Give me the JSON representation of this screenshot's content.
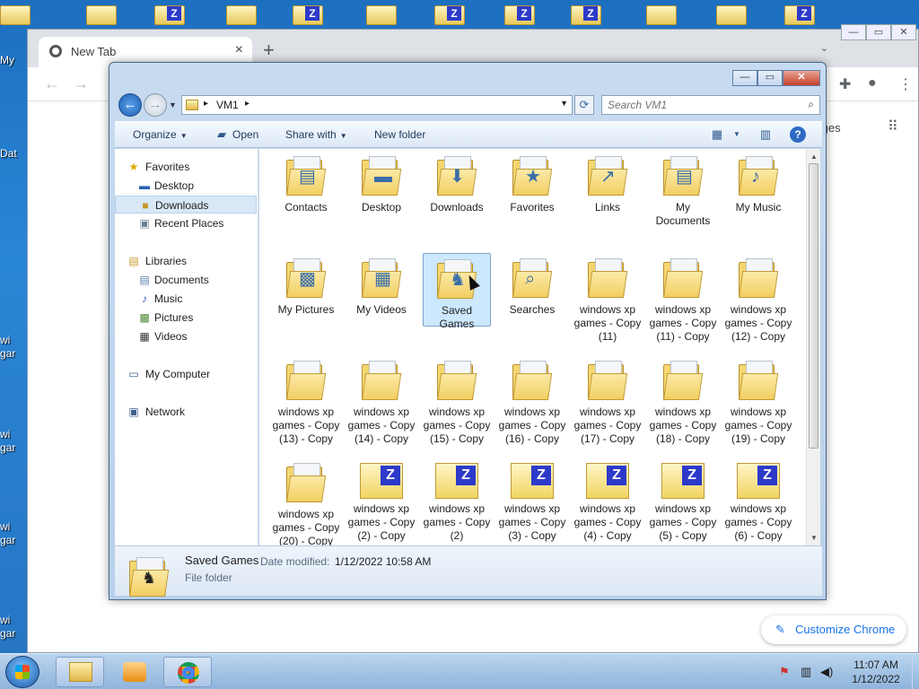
{
  "desktop": {
    "left_labels": [
      "My",
      "Dat",
      "wi",
      "gar",
      "wi",
      "gar",
      "wi",
      "gar",
      "wi",
      "gar"
    ]
  },
  "chrome": {
    "tab_title": "New Tab",
    "tab_close": "×",
    "new_tab": "+",
    "images_link": "Images",
    "customize_label": "Customize Chrome",
    "icons": {
      "extensions": "puzzle-icon",
      "profile": "profile-icon",
      "menu": "kebab-menu-icon",
      "apps": "apps-grid-icon"
    }
  },
  "explorer": {
    "breadcrumb": "VM1",
    "search_placeholder": "Search VM1",
    "window_controls": {
      "minimize": "—",
      "maximize": "▭",
      "close": "✕"
    },
    "commands": {
      "organize": "Organize",
      "open": "Open",
      "share_with": "Share with",
      "new_folder": "New folder"
    },
    "nav": {
      "favorites": "Favorites",
      "desktop": "Desktop",
      "downloads": "Downloads",
      "recent_places": "Recent Places",
      "libraries": "Libraries",
      "documents": "Documents",
      "music": "Music",
      "pictures": "Pictures",
      "videos": "Videos",
      "my_computer": "My Computer",
      "network": "Network"
    },
    "items": [
      {
        "label": "Contacts",
        "icon": "folder"
      },
      {
        "label": "Desktop",
        "icon": "folder"
      },
      {
        "label": "Downloads",
        "icon": "folder"
      },
      {
        "label": "Favorites",
        "icon": "folder"
      },
      {
        "label": "Links",
        "icon": "folder"
      },
      {
        "label": "My Documents",
        "icon": "folder"
      },
      {
        "label": "My Music",
        "icon": "folder"
      },
      {
        "label": "My Pictures",
        "icon": "folder"
      },
      {
        "label": "My Videos",
        "icon": "folder"
      },
      {
        "label": "Saved Games",
        "icon": "folder"
      },
      {
        "label": "Searches",
        "icon": "folder"
      },
      {
        "label": "windows xp games - Copy (11)",
        "icon": "folder"
      },
      {
        "label": "windows xp games - Copy (11) - Copy",
        "icon": "folder"
      },
      {
        "label": "windows xp games - Copy (12) - Copy",
        "icon": "folder"
      },
      {
        "label": "windows xp games - Copy (13) - Copy",
        "icon": "folder"
      },
      {
        "label": "windows xp games - Copy (14) - Copy",
        "icon": "folder"
      },
      {
        "label": "windows xp games - Copy (15) - Copy",
        "icon": "folder"
      },
      {
        "label": "windows xp games - Copy (16) - Copy",
        "icon": "folder"
      },
      {
        "label": "windows xp games - Copy (17) - Copy",
        "icon": "folder"
      },
      {
        "label": "windows xp games - Copy (18) - Copy",
        "icon": "folder"
      },
      {
        "label": "windows xp games - Copy (19) - Copy",
        "icon": "folder"
      },
      {
        "label": "windows xp games - Copy (20) - Copy",
        "icon": "folder"
      },
      {
        "label": "windows xp games - Copy (2) - Copy",
        "icon": "zip"
      },
      {
        "label": "windows xp games - Copy (2)",
        "icon": "zip"
      },
      {
        "label": "windows xp games - Copy (3) - Copy",
        "icon": "zip"
      },
      {
        "label": "windows xp games - Copy (4) - Copy",
        "icon": "zip"
      },
      {
        "label": "windows xp games - Copy (5) - Copy",
        "icon": "zip"
      },
      {
        "label": "windows xp games - Copy (6) - Copy",
        "icon": "zip"
      }
    ],
    "selected_item": "Saved Games",
    "details": {
      "name": "Saved Games",
      "date_modified_label": "Date modified:",
      "date_modified_value": "1/12/2022 10:58 AM",
      "type": "File folder"
    }
  },
  "taskbar": {
    "time": "11:07 AM",
    "date": "1/12/2022"
  }
}
